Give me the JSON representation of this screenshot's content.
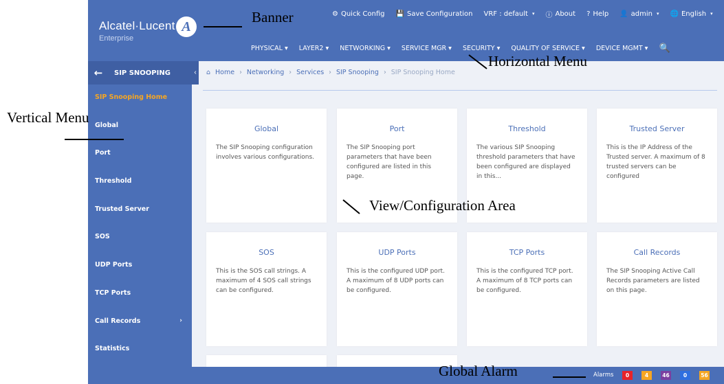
{
  "banner": {
    "logo_name": "Alcatel·Lucent",
    "logo_sub": "Enterprise",
    "logo_mark": "A",
    "top_items": [
      {
        "icon": "⚙",
        "label": "Quick Config",
        "caret": ""
      },
      {
        "icon": "💾",
        "label": "Save Configuration",
        "caret": ""
      },
      {
        "icon": "",
        "label": "VRF : default",
        "caret": "▾"
      },
      {
        "icon": "ⓘ",
        "label": "About",
        "caret": ""
      },
      {
        "icon": "?",
        "label": "Help",
        "caret": ""
      },
      {
        "icon": "👤",
        "label": "admin",
        "caret": "▾"
      },
      {
        "icon": "🌐",
        "label": "English",
        "caret": "▾"
      }
    ],
    "menu_items": [
      "PHYSICAL ▾",
      "LAYER2 ▾",
      "NETWORKING ▾",
      "SERVICE MGR ▾",
      "SECURITY ▾",
      "QUALITY OF SERVICE ▾",
      "DEVICE MGMT ▾"
    ],
    "search_icon": "🔍"
  },
  "sidebar": {
    "back_icon": "←",
    "title": "SIP SNOOPING",
    "collapse_icon": "‹",
    "items": [
      {
        "label": "SIP Snooping Home",
        "active": true
      },
      {
        "label": "Global"
      },
      {
        "label": "Port"
      },
      {
        "label": "Threshold"
      },
      {
        "label": "Trusted Server"
      },
      {
        "label": "SOS"
      },
      {
        "label": "UDP Ports"
      },
      {
        "label": "TCP Ports"
      },
      {
        "label": "Call Records",
        "chevron": "›"
      },
      {
        "label": "Statistics"
      }
    ]
  },
  "breadcrumb": {
    "home_icon": "⌂",
    "items": [
      "Home",
      "Networking",
      "Services",
      "SIP Snooping",
      "SIP Snooping Home"
    ],
    "separator": "›"
  },
  "cards": [
    {
      "title": "Global",
      "desc": "The SIP Snooping configuration involves various configurations."
    },
    {
      "title": "Port",
      "desc": "The SIP Snooping port parameters that have been configured are listed in this page."
    },
    {
      "title": "Threshold",
      "desc": "The various SIP Snooping threshold parameters that have been configured are displayed in this..."
    },
    {
      "title": "Trusted Server",
      "desc": "This is the IP Address of the Trusted server. A maximum of 8 trusted servers can be configured"
    },
    {
      "title": "SOS",
      "desc": "This is the SOS call strings. A maximum of 4 SOS call strings can be configured."
    },
    {
      "title": "UDP Ports",
      "desc": "This is the configured UDP port. A maximum of 8 UDP ports can be configured."
    },
    {
      "title": "TCP Ports",
      "desc": "This is the configured TCP port. A maximum of 8 TCP ports can be configured."
    },
    {
      "title": "Call Records",
      "desc": "The SIP Snooping Active Call Records parameters are listed on this page."
    }
  ],
  "alarms": {
    "label": "Alarms",
    "badges": [
      {
        "value": "0",
        "color": "#e8232a"
      },
      {
        "value": "4",
        "color": "#f6a623"
      },
      {
        "value": "46",
        "color": "#7b3fa0"
      },
      {
        "value": "0",
        "color": "#2f6fe0"
      },
      {
        "value": "56",
        "color": "#f6a623"
      }
    ]
  },
  "annotations": {
    "banner": "Banner",
    "horizontal_menu": "Horizontal Menu",
    "vertical_menu": "Vertical Menu",
    "view_area": "View/Configuration Area",
    "global_alarm": "Global Alarm"
  }
}
